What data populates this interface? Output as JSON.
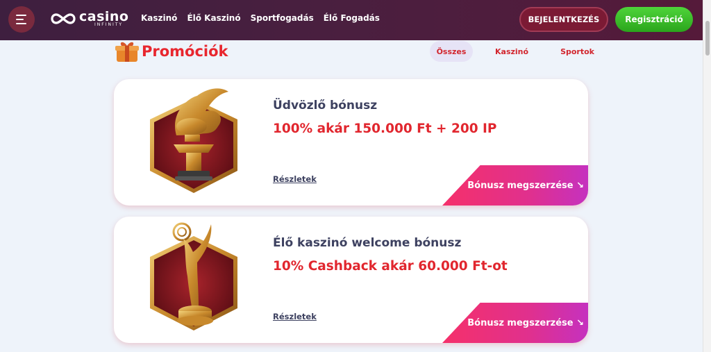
{
  "header": {
    "logo": {
      "main": "casino",
      "sub": "INFINITY"
    },
    "nav": [
      "Kaszinó",
      "Élő Kaszinó",
      "Sportfogadás",
      "Élő Fogadás"
    ],
    "login_label": "BEJELENTKEZÉS",
    "register_label": "Regisztráció"
  },
  "promotions": {
    "title": "Promóciók",
    "filters": [
      "Összes",
      "Kaszinó",
      "Sportok"
    ],
    "active_filter": "Összes",
    "cards": [
      {
        "title": "Üdvözlő bónusz",
        "offer": "100% akár 150.000 Ft + 200 IP",
        "details_label": "Részletek",
        "cta_label": "Bónusz megszerzése ↘",
        "image_icon": "winged-lion-trophy-icon"
      },
      {
        "title": "Élő kaszinó welcome bónusz",
        "offer": "10% Cashback akár 60.000 Ft-ot",
        "details_label": "Részletek",
        "cta_label": "Bónusz megszerzése ↘",
        "image_icon": "emmy-trophy-icon"
      }
    ]
  },
  "colors": {
    "header_bg": "#4a1f3f",
    "accent_red": "#e1262e",
    "register_green": "#2aa51c",
    "cta_pink": "#e0308e"
  }
}
